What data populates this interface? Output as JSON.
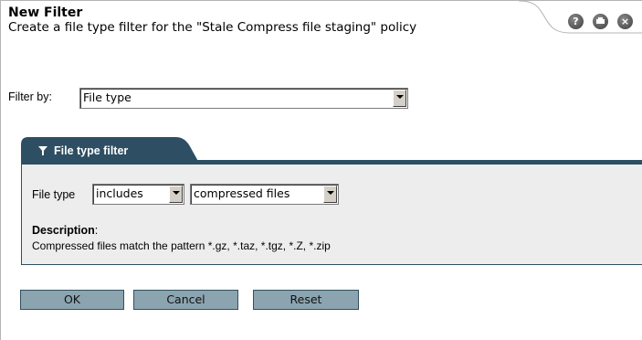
{
  "header": {
    "title": "New Filter",
    "subtitle": "Create a file type filter for the \"Stale Compress file staging\" policy",
    "icons": [
      "help-icon",
      "print-icon",
      "close-icon"
    ]
  },
  "filter_by": {
    "label": "Filter by:",
    "selected": "File type"
  },
  "tab": {
    "label": "File type filter",
    "icon": "funnel-icon"
  },
  "file_type": {
    "label": "File type",
    "operator_selected": "includes",
    "value_selected": "compressed files"
  },
  "description": {
    "label": "Description",
    "colon": ":",
    "text": "Compressed files match the pattern *.gz, *.taz, *.tgz, *.Z, *.zip"
  },
  "buttons": {
    "ok": "OK",
    "cancel": "Cancel",
    "reset": "Reset"
  },
  "colors": {
    "panel_border": "#2d4e63",
    "panel_bg": "#ededed",
    "button_bg": "#8ba4b0"
  }
}
